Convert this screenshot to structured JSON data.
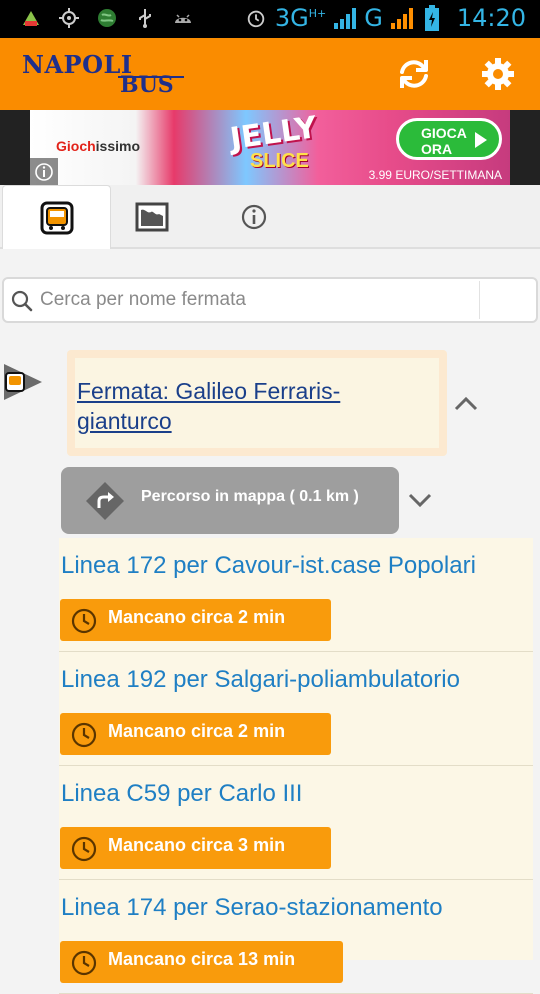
{
  "status_bar": {
    "network": "3G",
    "network_super": "H+",
    "network2": "G",
    "time": "14:20",
    "icons": [
      "app-icon",
      "gps-icon",
      "globe-icon",
      "usb-icon",
      "android-icon",
      "alarm-icon",
      "signal-icon",
      "battery-icon"
    ]
  },
  "app_bar": {
    "logo_line1": "NAPOLI",
    "logo_line2": "BUS",
    "refresh_icon": "refresh-icon",
    "settings_icon": "gear-icon",
    "background": "#fa8c00"
  },
  "banner": {
    "brand_prefix": "Gioch",
    "brand_suffix": "issimo",
    "game_line1": "JELLY",
    "game_line2": "SLICE",
    "cta": "GIOCA ORA",
    "price": "3.99 EURO/SETTIMANA"
  },
  "tabs": [
    {
      "icon": "bus-stop-icon",
      "active": true
    },
    {
      "icon": "map-icon",
      "active": false
    },
    {
      "icon": "info-icon",
      "active": false
    }
  ],
  "search": {
    "placeholder": "Cerca per nome fermata",
    "value": ""
  },
  "stop": {
    "title": "Fermata: Galileo Ferraris-gianturco",
    "route_button": "Percorso in mappa ( 0.1 km )"
  },
  "lines": [
    {
      "title": "Linea 172 per Cavour-ist.case Popolari",
      "eta": "Mancano circa 2 min"
    },
    {
      "title": "Linea 192 per Salgari-poliambulatorio",
      "eta": "Mancano circa 2 min"
    },
    {
      "title": "Linea C59 per Carlo III",
      "eta": "Mancano circa 3 min"
    },
    {
      "title": "Linea 174 per Serao-stazionamento",
      "eta": "Mancano circa 13 min"
    }
  ],
  "colors": {
    "accent": "#fa8c00",
    "eta_badge": "#f99b0c",
    "line_title": "#1f7fc4",
    "stop_link": "#1a3f8a",
    "status_text": "#34b5e5"
  }
}
